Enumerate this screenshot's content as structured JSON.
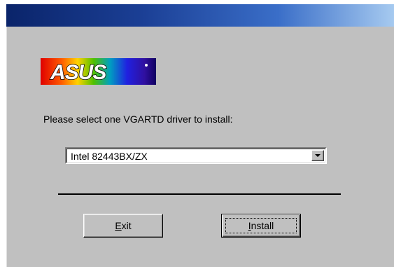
{
  "window": {
    "title": ""
  },
  "logo": {
    "text": "ASUS"
  },
  "prompt": {
    "text": "Please select one VGARTD driver to install:"
  },
  "driver_select": {
    "selected": "Intel 82443BX/ZX"
  },
  "buttons": {
    "exit": {
      "mnemonic": "E",
      "rest": "xit"
    },
    "install": {
      "mnemonic": "I",
      "rest": "nstall"
    }
  },
  "colors": {
    "window_bg": "#c0c0c0",
    "titlebar_start": "#0a246a",
    "titlebar_end": "#a6caf0"
  }
}
